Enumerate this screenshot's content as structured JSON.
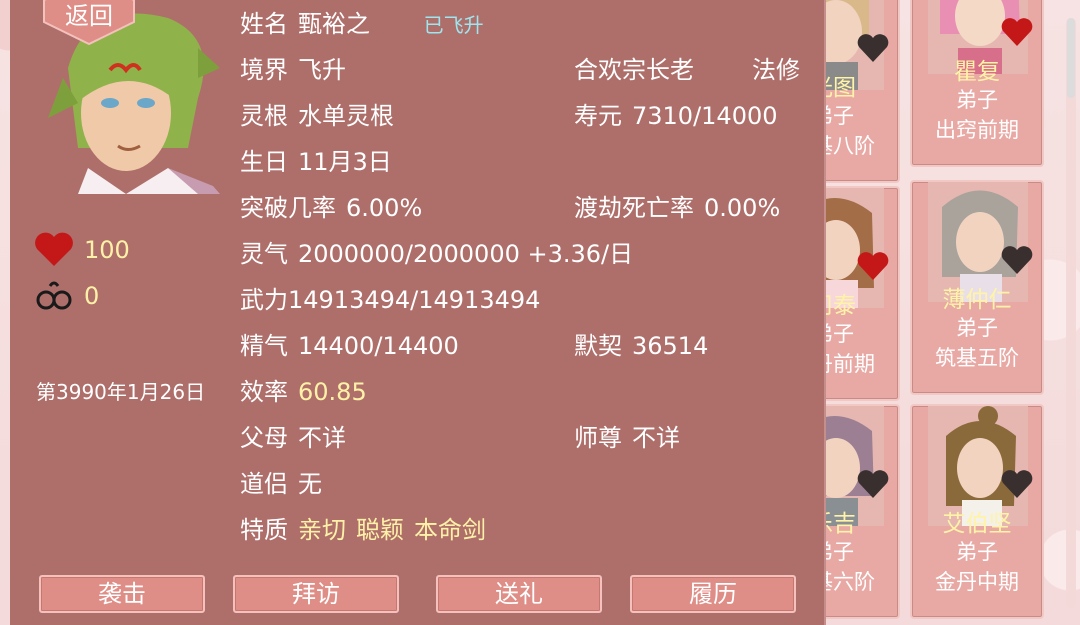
{
  "back_label": "返回",
  "character": {
    "name_label": "姓名",
    "name": "甄裕之",
    "ascended_tag": "已飞升",
    "realm_label": "境界",
    "realm": "飞升",
    "sect_title": "合欢宗长老",
    "class": "法修",
    "root_label": "灵根",
    "root": "水单灵根",
    "lifespan_label": "寿元",
    "lifespan": "7310/14000",
    "birthday_label": "生日",
    "birthday": "11月3日",
    "breakthrough_label": "突破几率",
    "breakthrough": "6.00%",
    "tribulation_label": "渡劫死亡率",
    "tribulation": "0.00%",
    "qi_label": "灵气",
    "qi": "2000000/2000000 +3.36/日",
    "force_label": "武力",
    "force": "14913494/14913494",
    "essence_label": "精气",
    "essence": "14400/14400",
    "rapport_label": "默契",
    "rapport": "36514",
    "efficiency_label": "效率",
    "efficiency": "60.85",
    "parents_label": "父母",
    "parents": "不详",
    "master_label": "师尊",
    "master": "不详",
    "partner_label": "道侣",
    "partner": "无",
    "traits_label": "特质",
    "traits": [
      "亲切",
      "聪颖",
      "本命剑"
    ]
  },
  "stats": {
    "affection": "100",
    "shackles": "0"
  },
  "date": "第3990年1月26日",
  "actions": [
    "袭击",
    "拜访",
    "送礼",
    "履历"
  ],
  "cards": [
    {
      "name": "光图",
      "role": "弟子",
      "rank": "筑基八阶",
      "heart": "dark"
    },
    {
      "name": "瞿复",
      "role": "弟子",
      "rank": "出窍前期",
      "heart": "red"
    },
    {
      "name": "司泰",
      "role": "弟子",
      "rank": "金丹前期",
      "heart": "red"
    },
    {
      "name": "薄仲仁",
      "role": "弟子",
      "rank": "筑基五阶",
      "heart": "dark"
    },
    {
      "name": "乐吉",
      "role": "弟子",
      "rank": "筑基六阶",
      "heart": "dark"
    },
    {
      "name": "艾伯坚",
      "role": "弟子",
      "rank": "金丹中期",
      "heart": "dark"
    }
  ],
  "colors": {
    "panel": "#ae6f6b",
    "accent_yellow": "#fff2a8",
    "tag_cyan": "#9ee6ef",
    "heart_red": "#c41818",
    "heart_dark": "#3a2f2f"
  }
}
